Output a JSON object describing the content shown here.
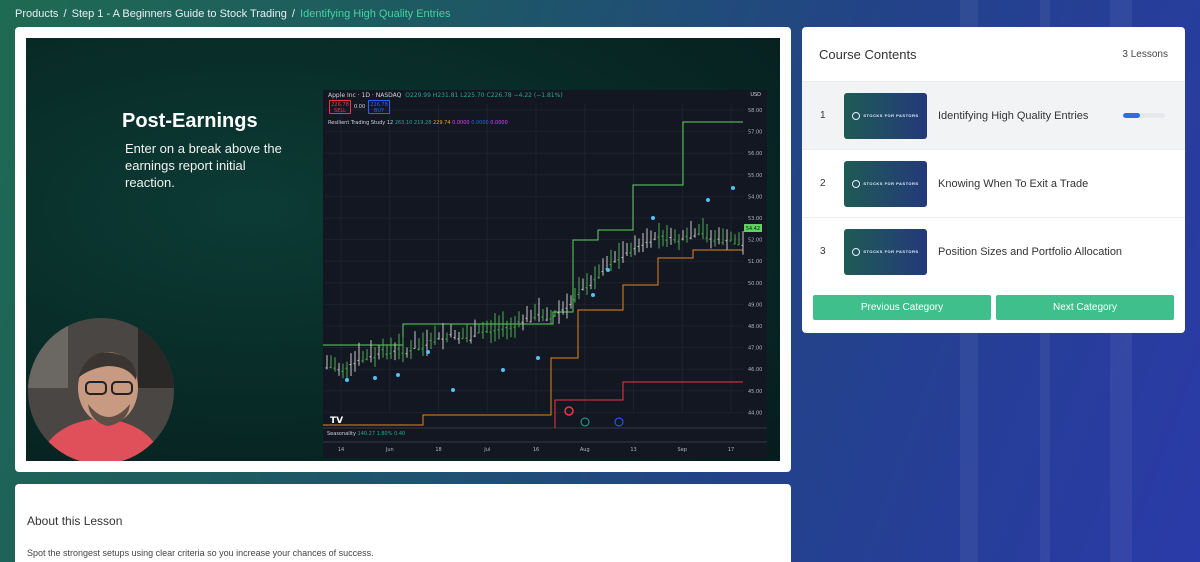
{
  "breadcrumb": {
    "items": [
      "Products",
      "Step 1 - A Beginners Guide to Stock Trading"
    ],
    "current": "Identifying High Quality Entries",
    "separator": "/"
  },
  "video": {
    "slide_title": "Post-Earnings",
    "slide_body": "Enter on a break above the earnings report initial reaction.",
    "chart": {
      "symbol_line": "Apple Inc · 1D · NASDAQ",
      "ohlc": "O229.99 H231.81 L225.70 C226.78 −4.22 (−1.81%)",
      "sell_price": "226.78",
      "sell_label": "SELL",
      "spread": "0.00",
      "buy_price": "226.78",
      "buy_label": "BUY",
      "indicator": "Resilient Trading Study 12",
      "ind_values": [
        "263.10",
        "219.28",
        "229.74",
        "0.0000",
        "0.0000",
        "0.0000"
      ],
      "currency": "USD",
      "seasonality": "Seasonality",
      "seasonality_values": "140.27 1.80% 0.40",
      "tv_logo": "TV",
      "price_ticks": [
        "58.00",
        "57.00",
        "56.00",
        "55.00",
        "54.00",
        "53.00",
        "52.00",
        "51.00",
        "50.00",
        "49.00",
        "48.00",
        "47.00",
        "46.00",
        "45.00",
        "44.00"
      ],
      "current_price_tag": "54.42",
      "time_ticks": [
        "14",
        "Jun",
        "18",
        "Jul",
        "16",
        "Aug",
        "13",
        "Sep",
        "17"
      ]
    }
  },
  "course": {
    "title": "Course Contents",
    "count": "3 Lessons",
    "thumb_text": "STOCKS FOR PASTORS",
    "lessons": [
      {
        "num": "1",
        "title": "Identifying High Quality Entries",
        "progress": 0.4
      },
      {
        "num": "2",
        "title": "Knowing When To Exit a Trade"
      },
      {
        "num": "3",
        "title": "Position Sizes and Portfolio Allocation"
      }
    ],
    "prev_label": "Previous Category",
    "next_label": "Next Category"
  },
  "about": {
    "heading": "About this Lesson",
    "text": "Spot the strongest setups using clear criteria so you increase your chances of success."
  },
  "colors": {
    "accent_green": "#3fbf8c",
    "breadcrumb_current": "#43d3a0",
    "progress_blue": "#2d6fe0"
  }
}
